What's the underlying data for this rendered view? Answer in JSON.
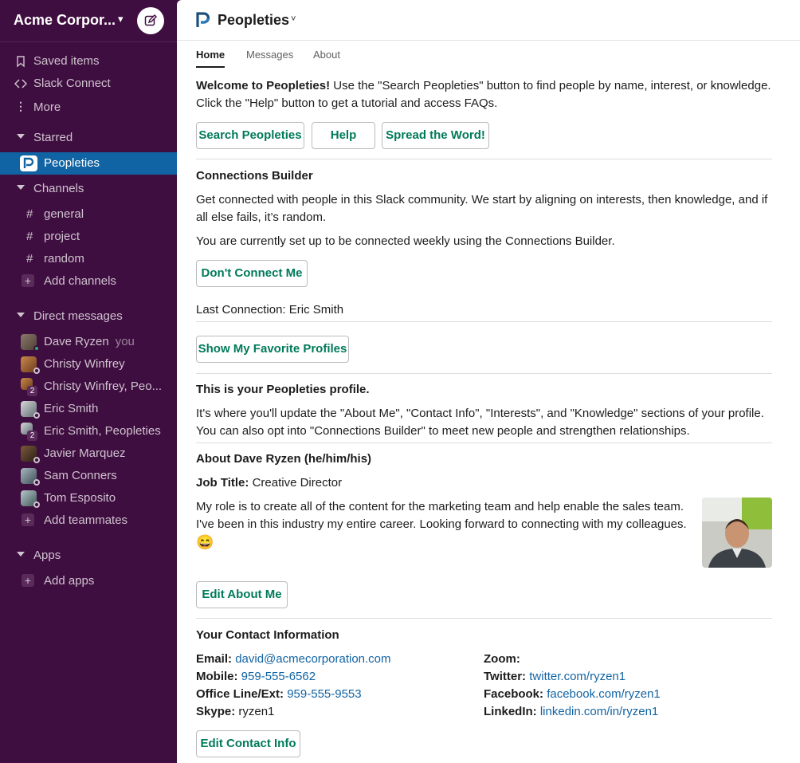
{
  "workspace": {
    "name": "Acme Corpor...",
    "chevron": "▾"
  },
  "sidebar": {
    "top_items": [
      {
        "label": "Saved items",
        "icon": "bookmark-icon"
      },
      {
        "label": "Slack Connect",
        "icon": "slack-connect-icon"
      },
      {
        "label": "More",
        "icon": "more-icon"
      }
    ],
    "starred": {
      "label": "Starred",
      "items": [
        {
          "label": "Peopleties"
        }
      ]
    },
    "channels": {
      "label": "Channels",
      "items": [
        {
          "label": "general"
        },
        {
          "label": "project"
        },
        {
          "label": "random"
        }
      ],
      "add_label": "Add channels"
    },
    "dms": {
      "label": "Direct messages",
      "items": [
        {
          "label": "Dave Ryzen",
          "suffix": "you"
        },
        {
          "label": "Christy Winfrey"
        },
        {
          "label": "Christy Winfrey, Peo...",
          "count": "2"
        },
        {
          "label": "Eric Smith"
        },
        {
          "label": "Eric Smith, Peopleties",
          "count": "2"
        },
        {
          "label": "Javier Marquez"
        },
        {
          "label": "Sam Conners"
        },
        {
          "label": "Tom Esposito"
        }
      ],
      "add_label": "Add teammates"
    },
    "apps": {
      "label": "Apps",
      "add_label": "Add apps"
    }
  },
  "app": {
    "title": "Peopleties",
    "chevron": "˅",
    "tabs": [
      {
        "label": "Home"
      },
      {
        "label": "Messages"
      },
      {
        "label": "About"
      }
    ]
  },
  "home": {
    "welcome_bold": "Welcome to Peopleties!",
    "welcome_line1": "  Use the \"Search Peopleties\" button to find people by name, interest, or knowledge.",
    "welcome_line2": "Click the \"Help\" button to get a tutorial and access FAQs.",
    "buttons": {
      "search": "Search Peopleties",
      "help": "Help",
      "spread": "Spread the Word!"
    },
    "connections": {
      "title": "Connections Builder",
      "line1": "Get connected with people in this Slack community.  We start by aligning on interests, then knowledge, and if",
      "line2": "all else fails, it’s random.",
      "status": "You are currently set up to be connected weekly using the Connections Builder.",
      "dont_connect": "Don't Connect Me",
      "last_connection": "Last Connection: Eric Smith"
    },
    "favorites_button": "Show My Favorite Profiles",
    "profile": {
      "title": "This is your Peopleties profile.",
      "line1": "It's where you'll update the \"About Me\", \"Contact Info\", \"Interests\", and \"Knowledge\" sections of your profile.",
      "line2": "You can also opt into \"Connections Builder\" to meet new people and strengthen relationships."
    },
    "about": {
      "title": "About Dave Ryzen (he/him/his)",
      "job_label": "Job Title:",
      "job_value": " Creative Director",
      "bio_line1": "My role is to create all of the content for the marketing team and help enable the sales team.",
      "bio_line2": "I've been in this industry my entire career. Looking forward to connecting with my colleagues.",
      "emoji": "😄",
      "edit_button": "Edit About Me"
    },
    "contact": {
      "title": "Your Contact Information",
      "email_label": "Email:",
      "email": "david@acmecorporation.com",
      "mobile_label": "Mobile:",
      "mobile": "959-555-6562",
      "office_label": "Office Line/Ext:",
      "office": "959-555-9553",
      "skype_label": "Skype:",
      "skype": " ryzen1",
      "zoom_label": "Zoom:",
      "twitter_label": "Twitter:",
      "twitter": "twitter.com/ryzen1",
      "facebook_label": "Facebook:",
      "facebook": "facebook.com/ryzen1",
      "linkedin_label": "LinkedIn:",
      "linkedin": "linkedin.com/in/ryzen1",
      "edit_button": "Edit Contact Info"
    }
  },
  "colors": {
    "sidebar_bg": "#3f0e40",
    "active": "#1164a3",
    "button_text": "#007a5a",
    "link": "#1264a3"
  }
}
